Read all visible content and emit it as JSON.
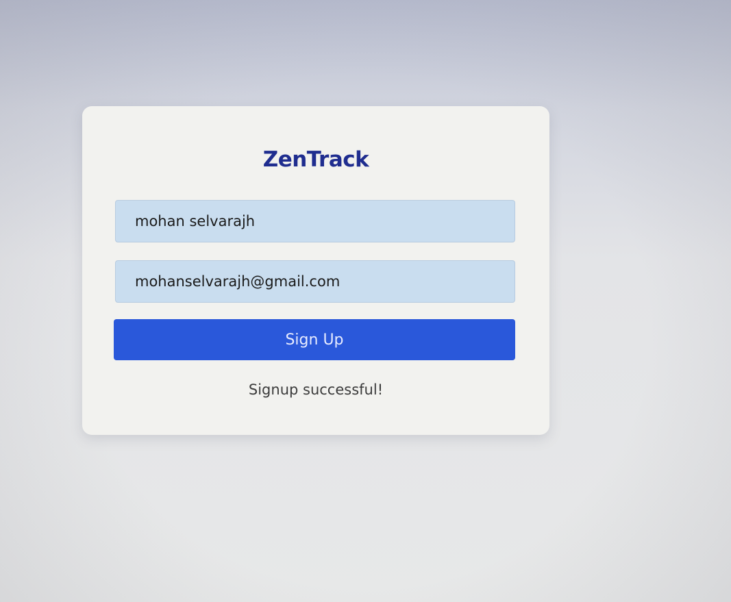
{
  "app": {
    "title": "ZenTrack"
  },
  "form": {
    "name_value": "mohan selvarajh",
    "email_value": "mohanselvarajh@gmail.com",
    "submit_label": "Sign Up",
    "status_message": "Signup successful!"
  },
  "colors": {
    "title": "#1f2d8f",
    "button": "#2a58da",
    "input_background": "#c9ddef",
    "card_background": "#f2f2ef"
  }
}
